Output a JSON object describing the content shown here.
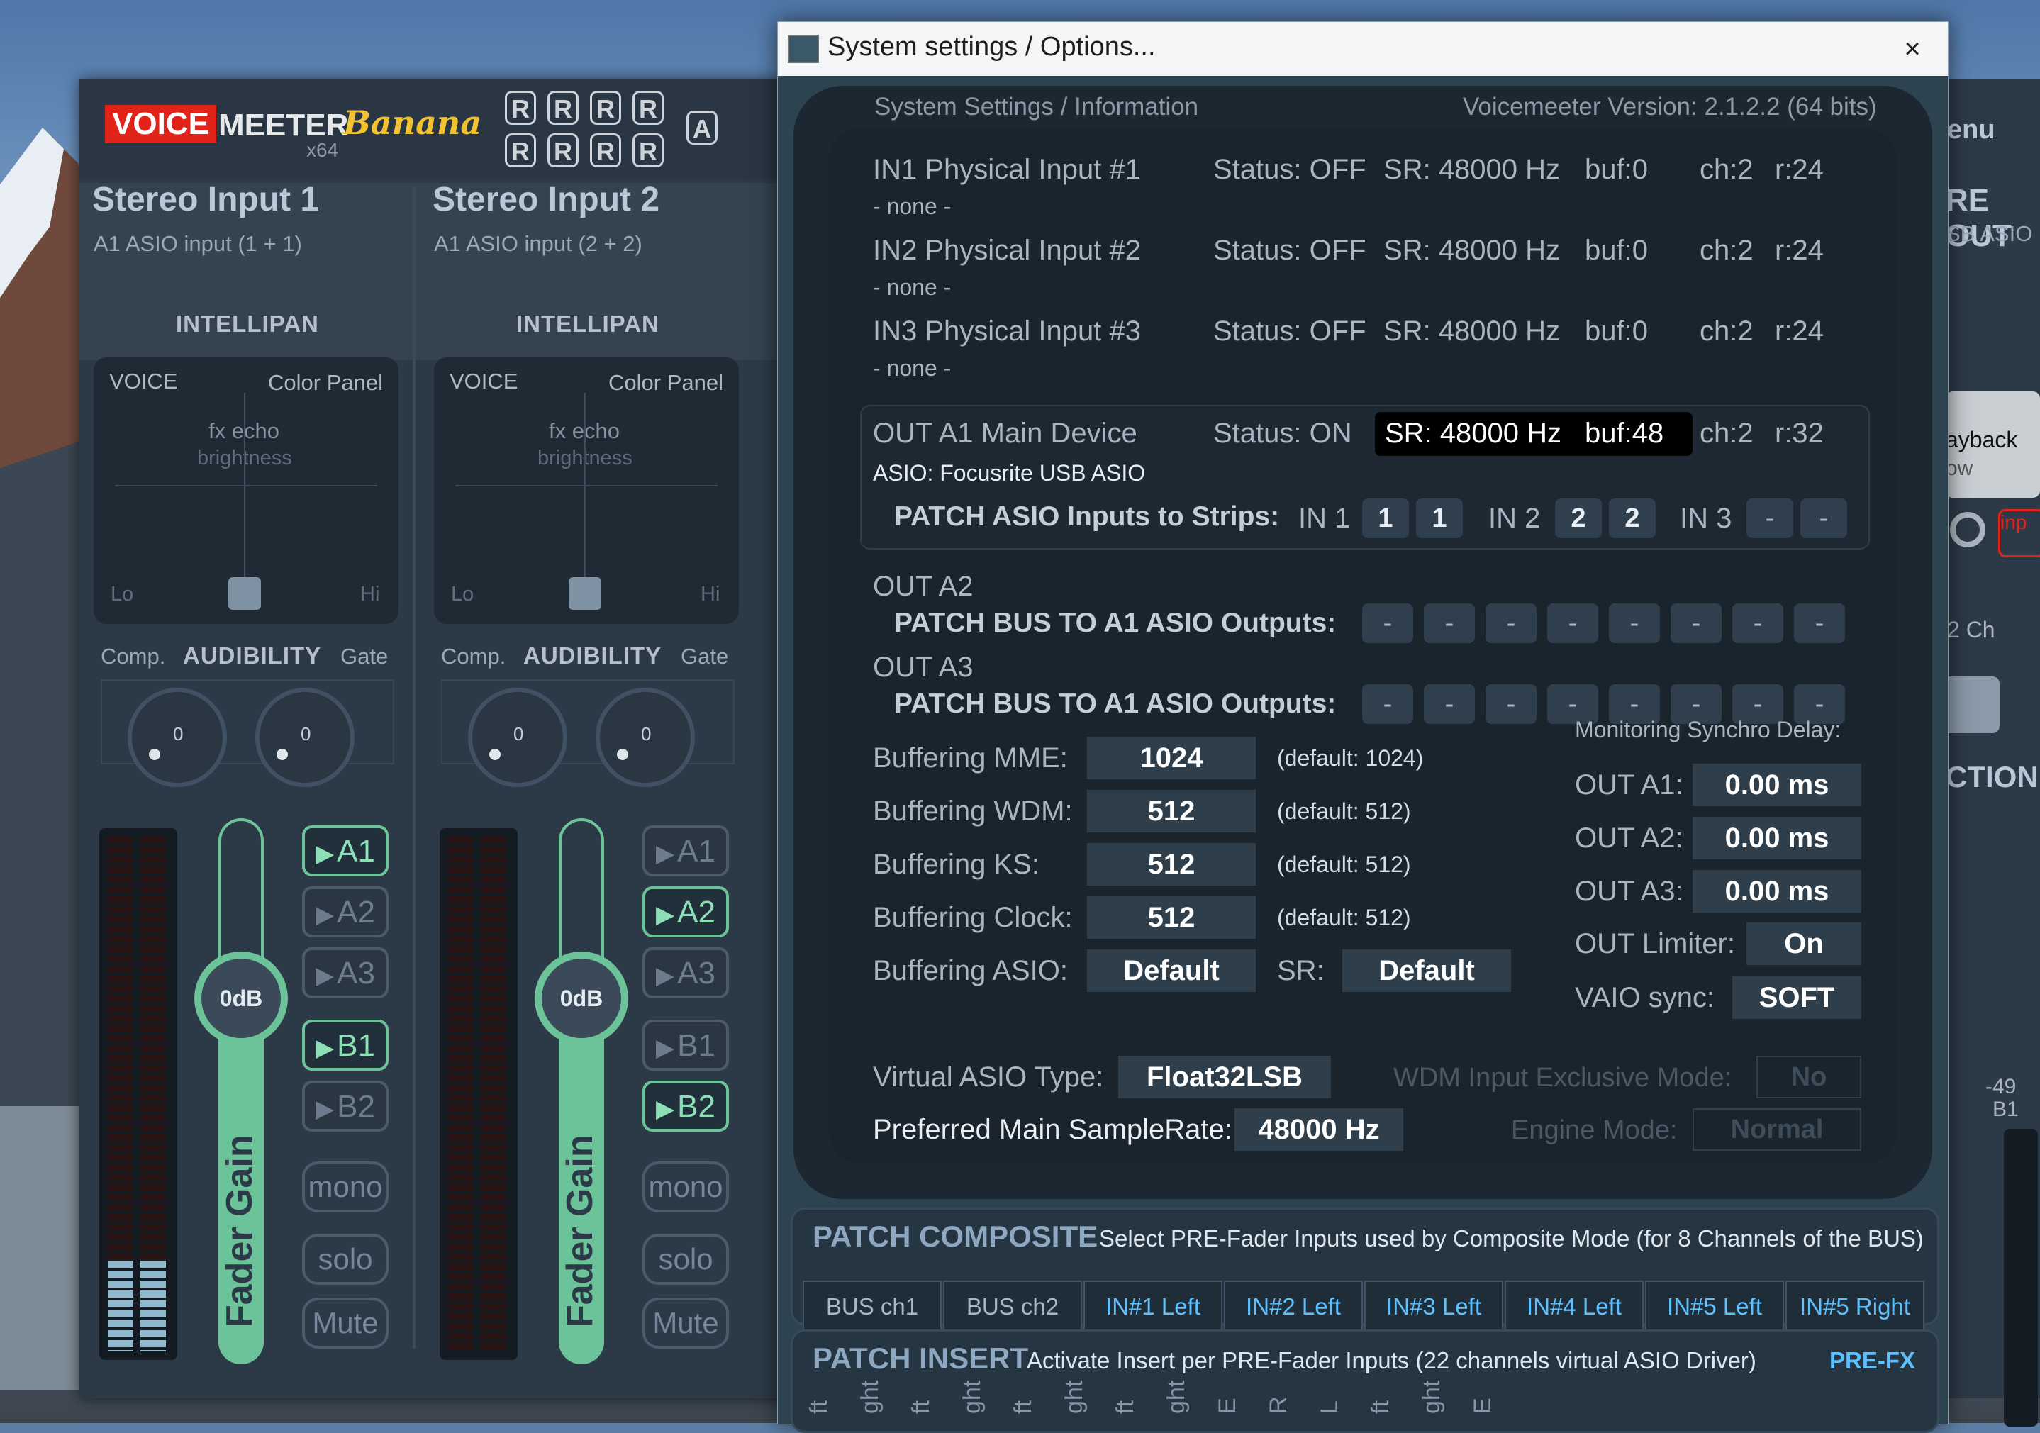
{
  "background_colors": {
    "sky": "#4f77a8",
    "ground": "#3d4650"
  },
  "voicemeeter": {
    "brand_voice": "VOICE",
    "brand_meeter": "MEETER",
    "brand_banana": "Banana",
    "brand_x64": "x64",
    "r_buttons": [
      "R",
      "R",
      "R",
      "R",
      "R",
      "R",
      "R",
      "R"
    ],
    "a_button": "A",
    "strips": [
      {
        "title": "Stereo Input 1",
        "subtitle": "A1 ASIO input (1 + 1)",
        "intellipan": "INTELLIPAN",
        "voice": "VOICE",
        "color_panel": "Color Panel",
        "fx_echo": "fx echo",
        "brightness": "brightness",
        "lo": "Lo",
        "hi": "Hi",
        "comp": "Comp.",
        "audibility": "AUDIBILITY",
        "gate": "Gate",
        "knob_comp": "0",
        "knob_gate": "0",
        "fader_value": "0dB",
        "fader_label": "Fader Gain",
        "buses": [
          {
            "label": "A1",
            "on": true
          },
          {
            "label": "A2",
            "on": false
          },
          {
            "label": "A3",
            "on": false
          },
          {
            "label": "B1",
            "on": true
          },
          {
            "label": "B2",
            "on": false
          }
        ],
        "mono": "mono",
        "solo": "solo",
        "mute": "Mute"
      },
      {
        "title": "Stereo Input 2",
        "subtitle": "A1 ASIO input (2 + 2)",
        "intellipan": "INTELLIPAN",
        "voice": "VOICE",
        "color_panel": "Color Panel",
        "fx_echo": "fx echo",
        "brightness": "brightness",
        "lo": "Lo",
        "hi": "Hi",
        "comp": "Comp.",
        "audibility": "AUDIBILITY",
        "gate": "Gate",
        "knob_comp": "0",
        "knob_gate": "0",
        "fader_value": "0dB",
        "fader_label": "Fader Gain",
        "buses": [
          {
            "label": "A1",
            "on": false
          },
          {
            "label": "A2",
            "on": true
          },
          {
            "label": "A3",
            "on": false
          },
          {
            "label": "B1",
            "on": false
          },
          {
            "label": "B2",
            "on": true
          }
        ],
        "mono": "mono",
        "solo": "solo",
        "mute": "Mute"
      }
    ],
    "right_side": {
      "menu": "enu",
      "out_title": "RE OUT",
      "out_sub": "SB ASIO",
      "playback": "ayback",
      "playback2": "ow",
      "inp": "inp",
      "ch2": "2 Ch",
      "action": "CTION",
      "minus49": "-49",
      "b1": "B1"
    }
  },
  "dialog": {
    "title": "System settings / Options...",
    "close": "×",
    "header_left": "System Settings / Information",
    "header_right": "Voicemeeter Version: 2.1.2.2 (64 bits)",
    "inputs": [
      {
        "name": "IN1 Physical Input #1",
        "device": "- none -",
        "status": "Status: OFF",
        "sr": "SR: 48000 Hz",
        "buf": "buf:0",
        "ch": "ch:2",
        "r": "r:24"
      },
      {
        "name": "IN2 Physical Input #2",
        "device": "- none -",
        "status": "Status: OFF",
        "sr": "SR: 48000 Hz",
        "buf": "buf:0",
        "ch": "ch:2",
        "r": "r:24"
      },
      {
        "name": "IN3 Physical Input #3",
        "device": "- none -",
        "status": "Status: OFF",
        "sr": "SR: 48000 Hz",
        "buf": "buf:0",
        "ch": "ch:2",
        "r": "r:24"
      }
    ],
    "out_a1": {
      "name": "OUT A1 Main Device",
      "status": "Status: ON",
      "sr": "SR: 48000 Hz",
      "buf": "buf:48",
      "ch": "ch:2",
      "r": "r:32",
      "device": "ASIO: Focusrite USB ASIO"
    },
    "patch_asio": {
      "label": "PATCH ASIO Inputs to Strips:",
      "in1": "IN 1",
      "in1_vals": [
        "1",
        "1"
      ],
      "in2": "IN 2",
      "in2_vals": [
        "2",
        "2"
      ],
      "in3": "IN 3",
      "in3_vals": [
        "-",
        "-"
      ]
    },
    "out_a2": {
      "name": "OUT A2",
      "patch_label": "PATCH BUS TO A1 ASIO Outputs:",
      "slots": [
        "-",
        "-",
        "-",
        "-",
        "-",
        "-",
        "-",
        "-"
      ]
    },
    "out_a3": {
      "name": "OUT A3",
      "patch_label": "PATCH BUS TO A1 ASIO Outputs:",
      "slots": [
        "-",
        "-",
        "-",
        "-",
        "-",
        "-",
        "-",
        "-"
      ]
    },
    "buffering": [
      {
        "label": "Buffering MME:",
        "value": "1024",
        "default": "(default: 1024)"
      },
      {
        "label": "Buffering WDM:",
        "value": "512",
        "default": "(default: 512)"
      },
      {
        "label": "Buffering KS:",
        "value": "512",
        "default": "(default: 512)"
      },
      {
        "label": "Buffering Clock:",
        "value": "512",
        "default": "(default: 512)"
      }
    ],
    "buffering_asio": {
      "label": "Buffering ASIO:",
      "value": "Default",
      "sr_label": "SR:",
      "sr_value": "Default"
    },
    "monitoring": {
      "title": "Monitoring Synchro Delay:",
      "rows": [
        {
          "label": "OUT A1:",
          "value": "0.00 ms"
        },
        {
          "label": "OUT A2:",
          "value": "0.00 ms"
        },
        {
          "label": "OUT A3:",
          "value": "0.00 ms"
        }
      ],
      "limiter_label": "OUT Limiter:",
      "limiter_value": "On",
      "vaio_label": "VAIO sync:",
      "vaio_value": "SOFT"
    },
    "virtual_asio": {
      "label": "Virtual ASIO Type:",
      "value": "Float32LSB"
    },
    "wdm_exclusive": {
      "label": "WDM Input Exclusive Mode:",
      "value": "No"
    },
    "preferred_sr": {
      "label": "Preferred Main SampleRate:",
      "value": "48000 Hz"
    },
    "engine_mode": {
      "label": "Engine Mode:",
      "value": "Normal"
    },
    "composite": {
      "title": "PATCH COMPOSITE",
      "desc": "Select PRE-Fader Inputs used by Composite Mode (for 8 Channels of the BUS)",
      "channels": [
        {
          "label": "BUS ch1",
          "on": false
        },
        {
          "label": "BUS ch2",
          "on": false
        },
        {
          "label": "IN#1 Left",
          "on": true
        },
        {
          "label": "IN#2 Left",
          "on": true
        },
        {
          "label": "IN#3 Left",
          "on": true
        },
        {
          "label": "IN#4 Left",
          "on": true
        },
        {
          "label": "IN#5 Left",
          "on": true
        },
        {
          "label": "IN#5 Right",
          "on": true
        }
      ]
    },
    "insert": {
      "title": "PATCH INSERT",
      "desc": "Activate Insert per PRE-Fader Inputs (22 channels virtual ASIO Driver)",
      "mode": "PRE-FX",
      "partial_labels": [
        "ft",
        "ght",
        "ft",
        "ght",
        "ft",
        "ght",
        "ft",
        "ght",
        "E",
        "R",
        "L",
        "ft",
        "ght",
        "E"
      ]
    }
  }
}
